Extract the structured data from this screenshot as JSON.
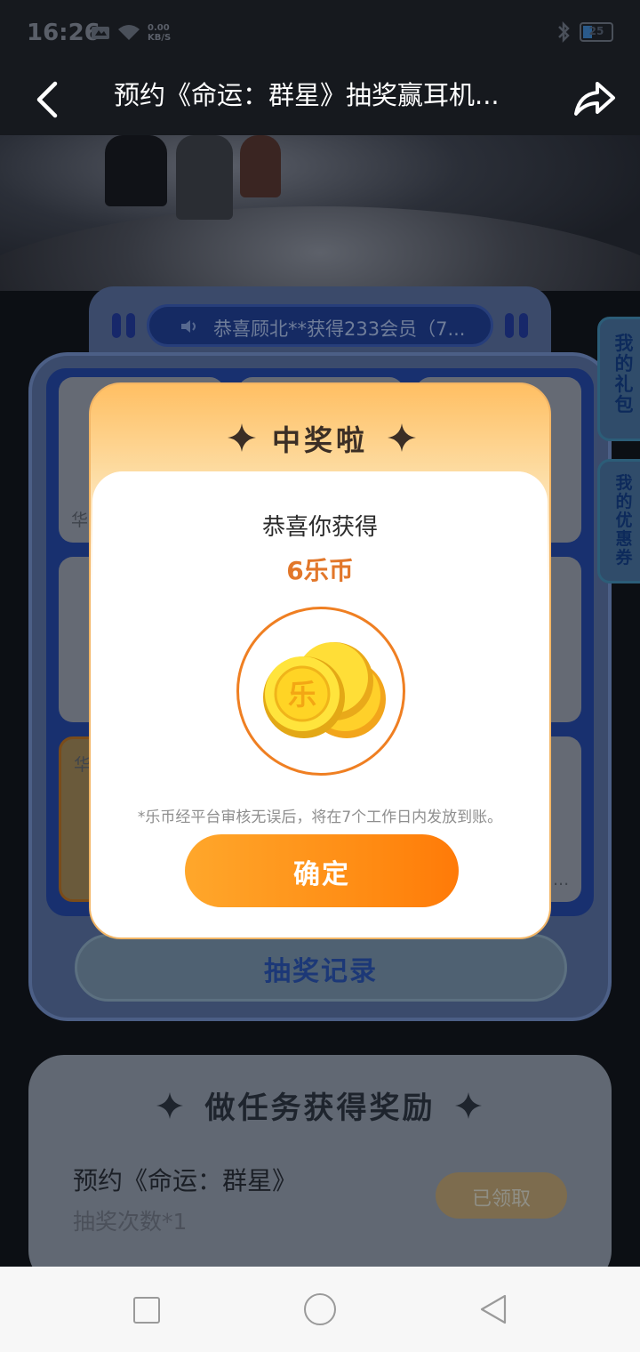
{
  "status_bar": {
    "time": "16:26",
    "net_speed_value": "0.00",
    "net_speed_unit": "KB/S",
    "battery_level": "25"
  },
  "title_bar": {
    "title": "预约《命运：群星》抽奖赢耳机..."
  },
  "marquee": {
    "text": "恭喜顾北**获得233会员（7..."
  },
  "lottery": {
    "cells": [
      {
        "label": "华"
      },
      {
        "label": ""
      },
      {
        "label": ""
      },
      {
        "label": ""
      },
      {
        "label": "华"
      },
      {
        "label": "..."
      }
    ],
    "record_button_label": "抽奖记录"
  },
  "side_tabs": [
    {
      "label": "我的礼包"
    },
    {
      "label": "我的优惠券"
    }
  ],
  "task_section": {
    "title": "做任务获得奖励",
    "task_title": "预约《命运：群星》",
    "task_subtitle": "抽奖次数*1",
    "task_button_label": "已领取"
  },
  "modal": {
    "title": "中奖啦",
    "congrats_text": "恭喜你获得",
    "prize_text": "6乐币",
    "coin_glyph": "乐",
    "note": "*乐币经平台审核无误后，将在7个工作日内发放到账。",
    "confirm_label": "确定"
  },
  "colors": {
    "accent_orange": "#ff8a12",
    "prize_orange": "#e2772a",
    "modal_header": "#ffbf63",
    "lottery_blue": "#18306f"
  },
  "icons": [
    "back-arrow-icon",
    "share-icon",
    "speaker-icon",
    "sparkle-icon",
    "coin-icon",
    "bluetooth-icon",
    "wifi-icon",
    "battery-icon"
  ]
}
